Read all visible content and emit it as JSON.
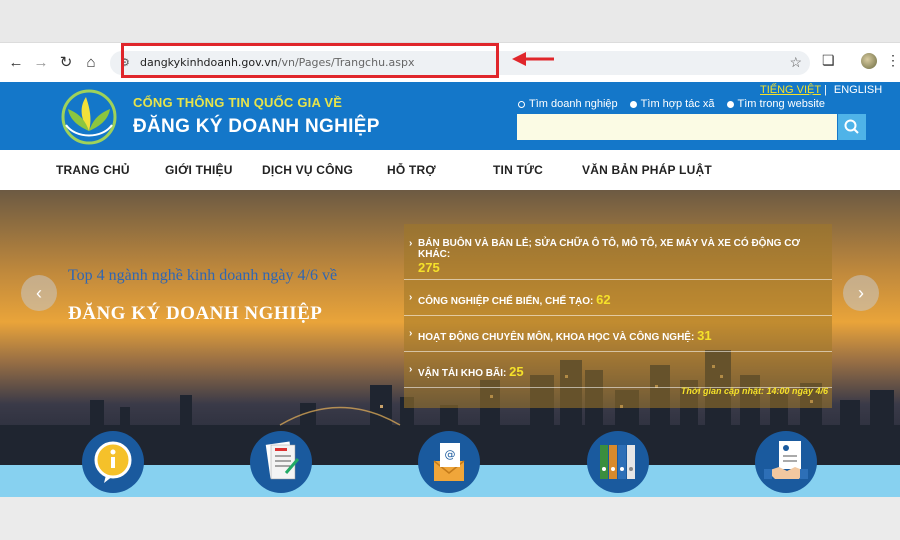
{
  "browser": {
    "url_host": "dangkykinhdoanh.gov.vn",
    "url_path": "/vn/Pages/Trangchu.aspx"
  },
  "header": {
    "brand_sub": "CỔNG THÔNG TIN QUỐC GIA VỀ",
    "brand_main": "ĐĂNG KÝ DOANH NGHIỆP",
    "lang_vi": "TIẾNG VIỆT",
    "lang_sep": "|",
    "lang_en": "ENGLISH",
    "search_options": [
      "Tìm doanh nghiệp",
      "Tìm hợp tác xã",
      "Tìm trong website"
    ]
  },
  "nav": [
    "TRANG CHỦ",
    "GIỚI THIỆU",
    "DỊCH VỤ CÔNG",
    "HỖ TRỢ",
    "TIN TỨC",
    "VĂN BẢN PHÁP LUẬT"
  ],
  "banner": {
    "subtitle": "Top 4 ngành nghề kinh doanh ngày 4/6 về",
    "title": "ĐĂNG KÝ DOANH NGHIỆP",
    "stats": [
      {
        "label": "BÁN BUÔN VÀ BÁN LẺ; SỬA CHỮA Ô TÔ, MÔ TÔ, XE MÁY VÀ XE CÓ ĐỘNG CƠ KHÁC:",
        "value": "275"
      },
      {
        "label": "CÔNG NGHIỆP CHẾ BIẾN, CHẾ TẠO:",
        "value": "62"
      },
      {
        "label": "HOẠT ĐỘNG CHUYÊN MÔN, KHOA HỌC VÀ CÔNG NGHỆ:",
        "value": "31"
      },
      {
        "label": "VẬN TẢI KHO BÃI:",
        "value": "25"
      }
    ],
    "update_time": "Thời gian cập nhật: 14:00 ngày 4/6"
  },
  "icons": [
    "info-icon",
    "form-document-icon",
    "email-document-icon",
    "binders-icon",
    "handshake-document-icon"
  ],
  "colors": {
    "header_blue": "#1477c9",
    "highlight_red": "#e0262b",
    "accent_yellow": "#f5e12a"
  }
}
